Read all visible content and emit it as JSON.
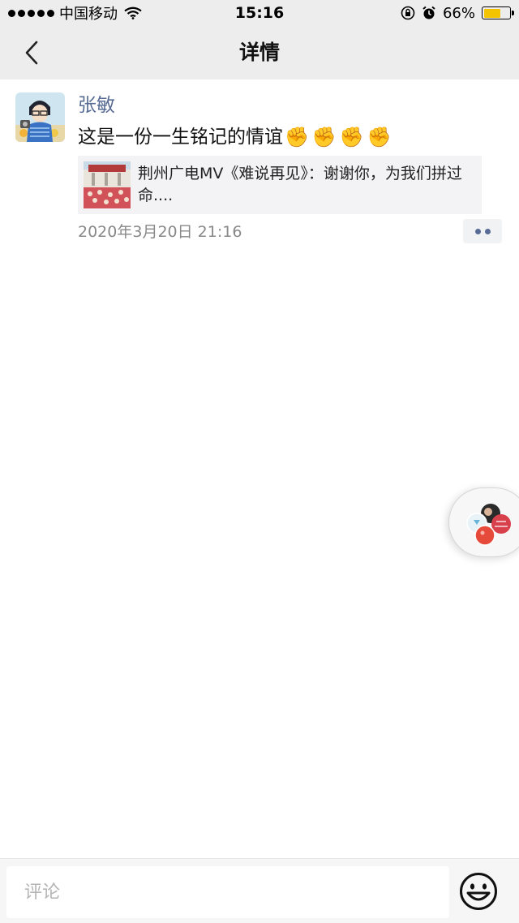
{
  "status_bar": {
    "carrier": "中国移动",
    "time": "15:16",
    "battery_percent": "66%",
    "battery_level": 0.66,
    "battery_color": "#f5c400"
  },
  "nav": {
    "title": "详情",
    "back_icon": "chevron-left-icon"
  },
  "post": {
    "author": "张敏",
    "text": "这是一份一生铭记的情谊",
    "emoji_icon": "raised-fist-icon",
    "emoji_count": 4,
    "link": {
      "title": "荆州广电MV《难说再见》：谢谢你，为我们拼过命...."
    },
    "timestamp": "2020年3月20日 21:16",
    "more_icon": "more-dots-icon"
  },
  "comment_bar": {
    "placeholder": "评论",
    "emoji_icon": "smiley-icon"
  },
  "colors": {
    "bar_bg": "#ededed",
    "name_link": "#576b95",
    "meta_gray": "#888888"
  }
}
